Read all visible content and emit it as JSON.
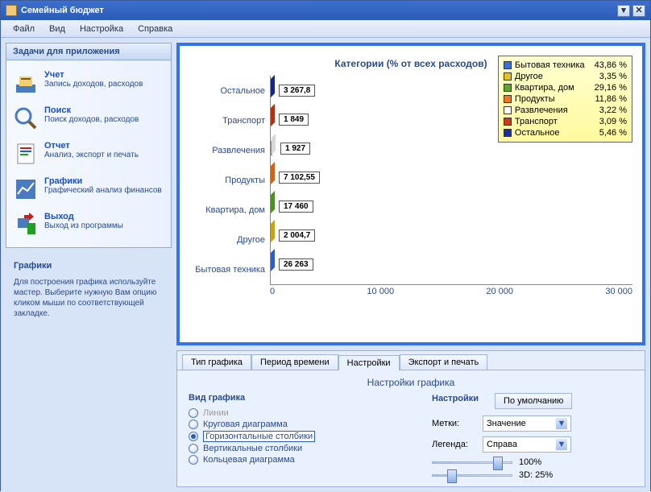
{
  "window": {
    "title": "Семейный бюджет"
  },
  "menu": [
    "Файл",
    "Вид",
    "Настройка",
    "Справка"
  ],
  "sidebar": {
    "header": "Задачи для приложения",
    "items": [
      {
        "title": "Учет",
        "desc": "Запись доходов, расходов"
      },
      {
        "title": "Поиск",
        "desc": "Поиск доходов, расходов"
      },
      {
        "title": "Отчет",
        "desc": "Анализ, экспорт и печать"
      },
      {
        "title": "Графики",
        "desc": "Графический анализ финансов"
      },
      {
        "title": "Выход",
        "desc": "Выход из программы"
      }
    ]
  },
  "help": {
    "title": "Графики",
    "text": "Для построения графика используйте мастер. Выберите нужную Вам опцию кликом мыши по соответствующей закладке."
  },
  "chart_data": {
    "type": "bar",
    "orientation": "horizontal",
    "title": "Категории (% от всех расходов)",
    "categories": [
      "Остальное",
      "Транспорт",
      "Развлечения",
      "Продукты",
      "Квартира, дом",
      "Другое",
      "Бытовая техника"
    ],
    "values": [
      3267.8,
      1849,
      1927,
      7102.55,
      17460,
      2004.7,
      26263
    ],
    "value_labels": [
      "3 267,8",
      "1 849",
      "1 927",
      "7 102,55",
      "17 460",
      "2 004,7",
      "26 263"
    ],
    "colors": [
      "#1a2f99",
      "#cf3a1a",
      "#ffffff",
      "#f07820",
      "#5aa82a",
      "#e8c020",
      "#3a6fe0"
    ],
    "xticks": [
      "0",
      "10 000",
      "20 000",
      "30 000"
    ],
    "xlim": [
      0,
      38000
    ],
    "legend": [
      {
        "label": "Бытовая техника",
        "pct": "43,86 %",
        "color": "#3a6fe0"
      },
      {
        "label": "Другое",
        "pct": "3,35 %",
        "color": "#e8c020"
      },
      {
        "label": "Квартира, дом",
        "pct": "29,16 %",
        "color": "#5aa82a"
      },
      {
        "label": "Продукты",
        "pct": "11,86 %",
        "color": "#f07820"
      },
      {
        "label": "Развлечения",
        "pct": "3,22 %",
        "color": "#ffffff"
      },
      {
        "label": "Транспорт",
        "pct": "3,09 %",
        "color": "#cf3a1a"
      },
      {
        "label": "Остальное",
        "pct": "5,46 %",
        "color": "#1a2f99"
      }
    ]
  },
  "tabs": [
    "Тип графика",
    "Период времени",
    "Настройки",
    "Экспорт и печать"
  ],
  "active_tab": 2,
  "settings": {
    "panel_title": "Настройки графика",
    "type_header": "Вид графика",
    "ctrl_header": "Настройки",
    "default_btn": "По умолчанию",
    "types": [
      {
        "label": "Линии",
        "enabled": false,
        "checked": false
      },
      {
        "label": "Круговая диаграмма",
        "enabled": true,
        "checked": false
      },
      {
        "label": "Горизонтальные столбики",
        "enabled": true,
        "checked": true
      },
      {
        "label": "Вертикальные столбики",
        "enabled": true,
        "checked": false
      },
      {
        "label": "Кольцевая диаграмма",
        "enabled": true,
        "checked": false
      }
    ],
    "labels_lbl": "Метки:",
    "labels_val": "Значение",
    "legend_lbl": "Легенда:",
    "legend_val": "Справа",
    "slider1": "100%",
    "slider2": "3D: 25%"
  }
}
